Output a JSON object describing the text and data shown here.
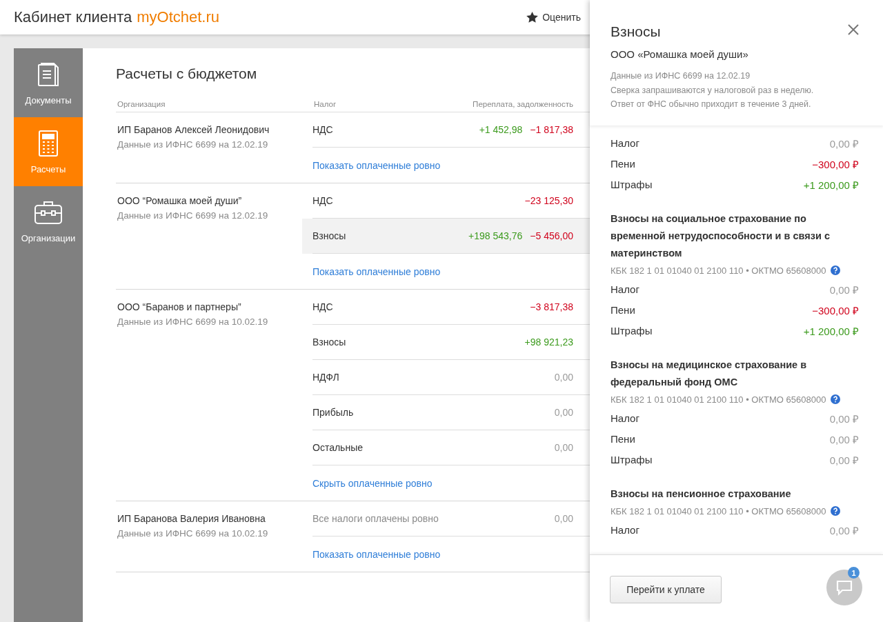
{
  "header": {
    "title": "Кабинет клиента",
    "brand": "myOtchet.ru",
    "rate_label": "Оценить"
  },
  "sidebar": {
    "items": [
      {
        "label": "Документы",
        "kind": "documents",
        "selected": false
      },
      {
        "label": "Расчеты",
        "kind": "calculator",
        "selected": true
      },
      {
        "label": "Организации",
        "kind": "briefcase",
        "selected": false
      }
    ]
  },
  "budget": {
    "title": "Расчеты с бюджетом",
    "columns": [
      "Организация",
      "Налог",
      "Переплата, задолженность"
    ],
    "organizations": [
      {
        "name": "ИП Баранов Алексей Леонидович",
        "date_note": "Данные из ИФНС 6699 на 12.02.19",
        "toggle": "Показать оплаченные ровно",
        "taxes": [
          {
            "kind": "tax",
            "label": "НДС",
            "selected": false,
            "amounts": [
              {
                "text": "+1 452,98",
                "kind": "plus"
              },
              {
                "text": "−1 817,38",
                "kind": "minus"
              }
            ]
          }
        ]
      },
      {
        "name": "ООО “Ромашка моей души”",
        "date_note": "Данные из ИФНС 6699 на 12.02.19",
        "toggle": "Показать оплаченные ровно",
        "taxes": [
          {
            "kind": "tax",
            "label": "НДС",
            "selected": false,
            "amounts": [
              {
                "text": "−23 125,30",
                "kind": "minus"
              }
            ]
          },
          {
            "kind": "tax",
            "label": "Взносы",
            "selected": true,
            "amounts": [
              {
                "text": "+198 543,76",
                "kind": "plus"
              },
              {
                "text": "−5 456,00",
                "kind": "minus"
              }
            ]
          }
        ]
      },
      {
        "name": "ООО “Баранов и партнеры”",
        "date_note": "Данные из ИФНС 6699 на 10.02.19",
        "toggle": "Скрыть оплаченные ровно",
        "taxes": [
          {
            "kind": "tax",
            "label": "НДС",
            "selected": false,
            "amounts": [
              {
                "text": "−3 817,38",
                "kind": "minus"
              }
            ]
          },
          {
            "kind": "tax",
            "label": "Взносы",
            "selected": false,
            "amounts": [
              {
                "text": "+98 921,23",
                "kind": "plus"
              }
            ]
          },
          {
            "kind": "tax",
            "label": "НДФЛ",
            "selected": false,
            "amounts": [
              {
                "text": "0,00",
                "kind": "zero"
              }
            ]
          },
          {
            "kind": "tax",
            "label": "Прибыль",
            "selected": false,
            "amounts": [
              {
                "text": "0,00",
                "kind": "zero"
              }
            ]
          },
          {
            "kind": "tax",
            "label": "Остальные",
            "selected": false,
            "amounts": [
              {
                "text": "0,00",
                "kind": "zero"
              }
            ]
          }
        ]
      },
      {
        "name": "ИП Баранова Валерия Ивановна",
        "date_note": "Данные из ИФНС 6699 на 10.02.19",
        "toggle": "Показать оплаченные ровно",
        "taxes": [
          {
            "kind": "summary",
            "label": "Все налоги оплачены ровно",
            "selected": false,
            "amounts": [
              {
                "text": "0,00",
                "kind": "zero"
              }
            ]
          }
        ]
      }
    ]
  },
  "panel": {
    "title": "Взносы",
    "organization": "ООО «Ромашка моей души»",
    "notes": [
      "Данные из ИФНС 6699 на 12.02.19",
      "Сверка запрашиваются у налоговой раз в неделю.",
      "Ответ от ФНС обычно приходит в течение 3 дней."
    ],
    "groups": [
      {
        "rows": [
          {
            "label": "Налог",
            "value": "0,00 ₽",
            "kind": "zero"
          },
          {
            "label": "Пени",
            "value": "−300,00 ₽",
            "kind": "minus"
          },
          {
            "label": "Штрафы",
            "value": "+1 200,00 ₽",
            "kind": "plus"
          }
        ]
      },
      {
        "title": "Взносы на социальное страхование по временной нетрудоспособности и в связи с материнством",
        "codes": "КБК 182 1 01 01040 01 2100 110 • ОКТМО 65608000",
        "rows": [
          {
            "label": "Налог",
            "value": "0,00 ₽",
            "kind": "zero"
          },
          {
            "label": "Пени",
            "value": "−300,00 ₽",
            "kind": "minus"
          },
          {
            "label": "Штрафы",
            "value": "+1 200,00 ₽",
            "kind": "plus"
          }
        ]
      },
      {
        "title": "Взносы на медицинское страхование в федеральный фонд ОМС",
        "codes": "КБК 182 1 01 01040 01 2100 110 • ОКТМО 65608000",
        "rows": [
          {
            "label": "Налог",
            "value": "0,00 ₽",
            "kind": "zero"
          },
          {
            "label": "Пени",
            "value": "0,00 ₽",
            "kind": "zero"
          },
          {
            "label": "Штрафы",
            "value": "0,00 ₽",
            "kind": "zero"
          }
        ]
      },
      {
        "title": "Взносы на пенсионное страхование",
        "codes": "КБК 182 1 01 01040 01 2100 110 • ОКТМО 65608000",
        "rows": [
          {
            "label": "Налог",
            "value": "0,00 ₽",
            "kind": "zero"
          }
        ]
      }
    ],
    "pay_button": "Перейти к уплате",
    "chat_badge": "1"
  }
}
